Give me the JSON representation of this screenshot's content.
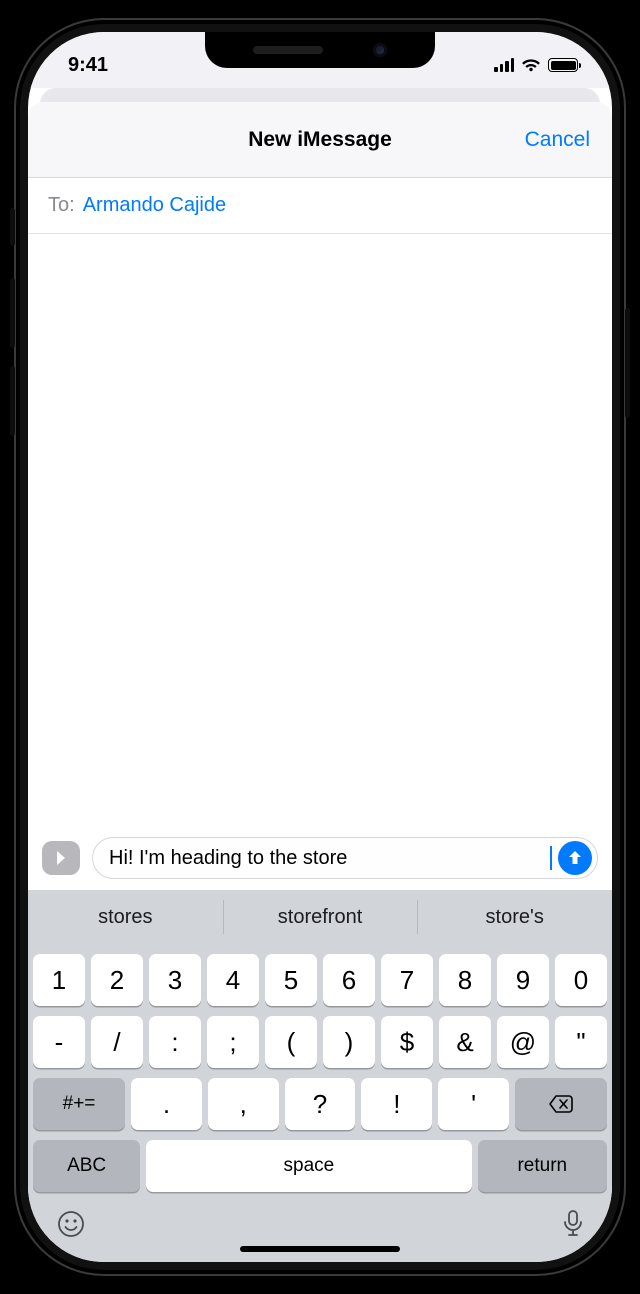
{
  "status": {
    "time": "9:41"
  },
  "nav": {
    "title": "New iMessage",
    "cancel": "Cancel"
  },
  "to": {
    "label": "To:",
    "recipient": "Armando Cajide"
  },
  "compose": {
    "text": "Hi! I'm heading to the store"
  },
  "suggestions": [
    "stores",
    "storefront",
    "store's"
  ],
  "keys": {
    "row1": [
      "1",
      "2",
      "3",
      "4",
      "5",
      "6",
      "7",
      "8",
      "9",
      "0"
    ],
    "row2": [
      "-",
      "/",
      ":",
      ";",
      "(",
      ")",
      "$",
      "&",
      "@",
      "\""
    ],
    "row3_sym": "#+=",
    "row3": [
      ".",
      ",",
      "?",
      "!",
      "'"
    ],
    "abc": "ABC",
    "space": "space",
    "return": "return"
  }
}
